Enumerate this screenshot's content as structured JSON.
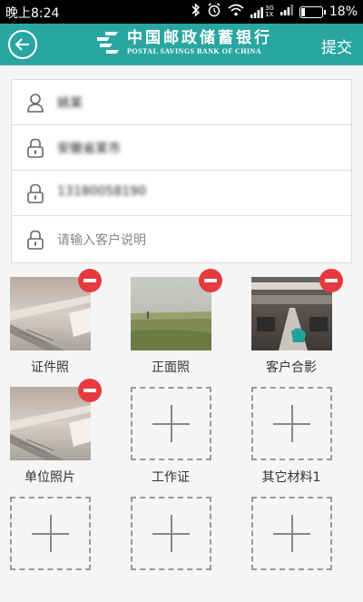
{
  "status_bar": {
    "time": "晚上8:24",
    "network_top": "3G",
    "network_bottom": "1X",
    "battery_percent": "18%",
    "battery_level": 0.18
  },
  "app_bar": {
    "bank_name_cn": "中国邮政储蓄银行",
    "bank_name_en": "POSTAL SAVINGS BANK OF CHINA",
    "submit_label": "提交"
  },
  "form": {
    "name_value": "姚某",
    "address_value": "安徽省某市",
    "phone_value": "13180058190",
    "description_placeholder": "请输入客户说明"
  },
  "photos": [
    {
      "label": "证件照",
      "has_image": true,
      "image": "ceiling"
    },
    {
      "label": "正面照",
      "has_image": true,
      "image": "field"
    },
    {
      "label": "客户合影",
      "has_image": true,
      "image": "hall"
    },
    {
      "label": "单位照片",
      "has_image": true,
      "image": "ceiling"
    },
    {
      "label": "工作证",
      "has_image": false
    },
    {
      "label": "其它材料1",
      "has_image": false
    },
    {
      "label": "",
      "has_image": false
    },
    {
      "label": "",
      "has_image": false
    },
    {
      "label": "",
      "has_image": false
    }
  ],
  "colors": {
    "app_bar": "#2aa6a2",
    "remove_badge": "#e63a3e"
  }
}
